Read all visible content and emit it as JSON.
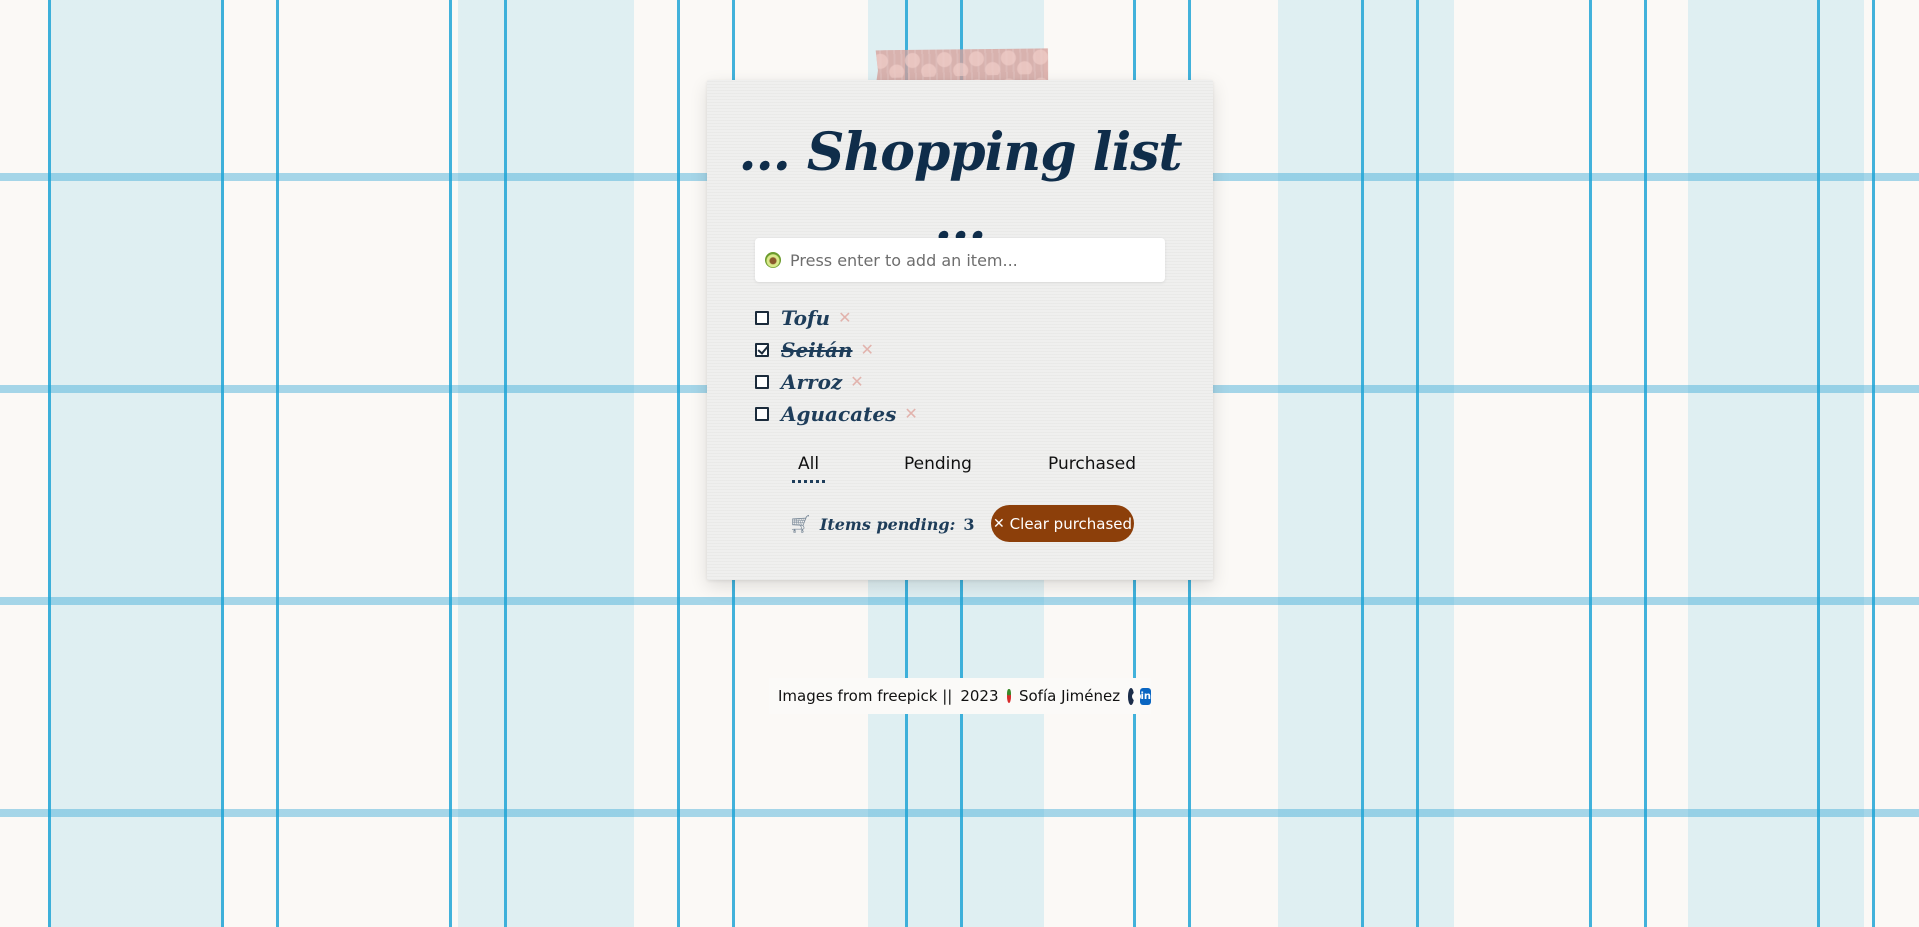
{
  "title": "... Shopping list ...",
  "add_item": {
    "icon": "avocado-icon",
    "placeholder": "Press enter to add an item..."
  },
  "items": [
    {
      "label": "Tofu",
      "checked": false
    },
    {
      "label": "Seitán",
      "checked": true
    },
    {
      "label": "Arroz",
      "checked": false
    },
    {
      "label": "Aguacates",
      "checked": false
    }
  ],
  "filters": [
    {
      "label": "All",
      "active": true
    },
    {
      "label": "Pending",
      "active": false
    },
    {
      "label": "Purchased",
      "active": false
    }
  ],
  "summary": {
    "pending_label": "Items pending:",
    "pending_count": "3",
    "icon": "cart-icon"
  },
  "clear_button": {
    "label": "Clear purchased",
    "icon": "close-icon",
    "color": "#8c3f0a"
  },
  "footer": {
    "credits": "Images from freepick ||",
    "year": "2023",
    "author": "Sofía Jiménez",
    "icons": [
      "strawberry-icon",
      "github-icon",
      "linkedin-icon"
    ]
  },
  "colors": {
    "title": "#0f2d4a",
    "item_text": "#1e3d5a",
    "delete_icon": "#e2b3ad",
    "background_stripe": "#21a5d6"
  }
}
